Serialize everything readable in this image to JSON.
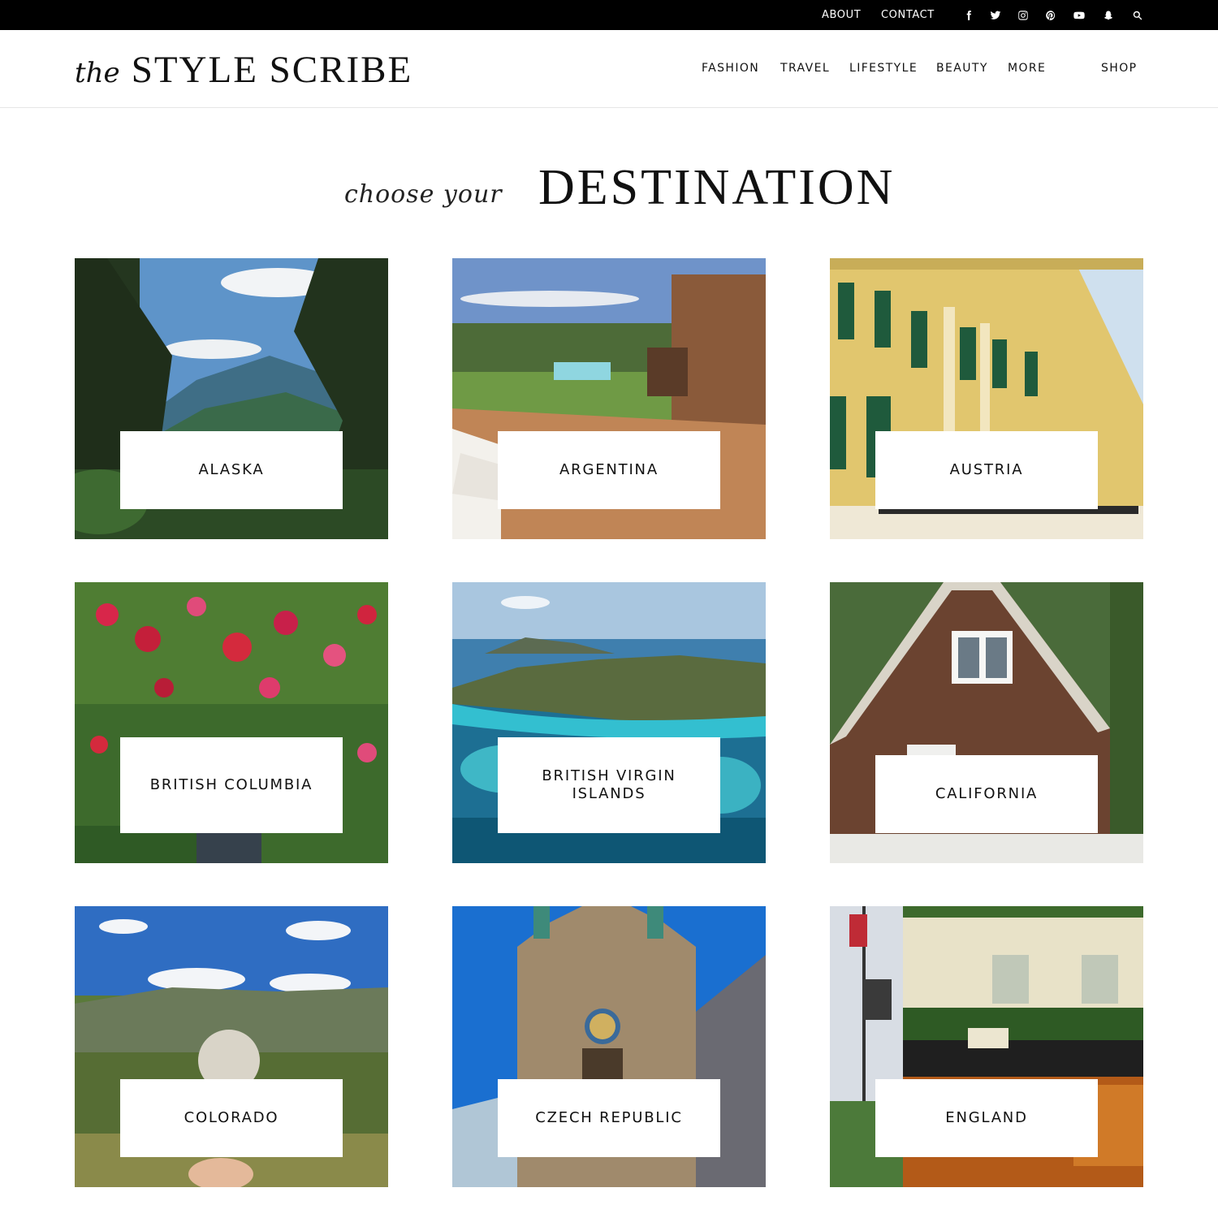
{
  "topbar": {
    "links": [
      "ABOUT",
      "CONTACT"
    ],
    "social_icons": [
      "facebook-icon",
      "twitter-icon",
      "instagram-icon",
      "pinterest-icon",
      "youtube-icon",
      "snapchat-icon",
      "search-icon"
    ]
  },
  "header": {
    "logo_prefix": "the",
    "logo_name": "STYLE SCRIBE",
    "nav": [
      "FASHION",
      "TRAVEL",
      "LIFESTYLE",
      "BEAUTY",
      "MORE",
      "SHOP"
    ]
  },
  "heading": {
    "script": "choose your",
    "main": "DESTINATION"
  },
  "destinations": [
    "ALASKA",
    "ARGENTINA",
    "AUSTRIA",
    "BRITISH COLUMBIA",
    "BRITISH VIRGIN ISLANDS",
    "CALIFORNIA",
    "COLORADO",
    "CZECH REPUBLIC",
    "ENGLAND"
  ],
  "colors": {
    "topbar": "#000000",
    "text": "#111111",
    "divider": "#e6e6e6"
  }
}
